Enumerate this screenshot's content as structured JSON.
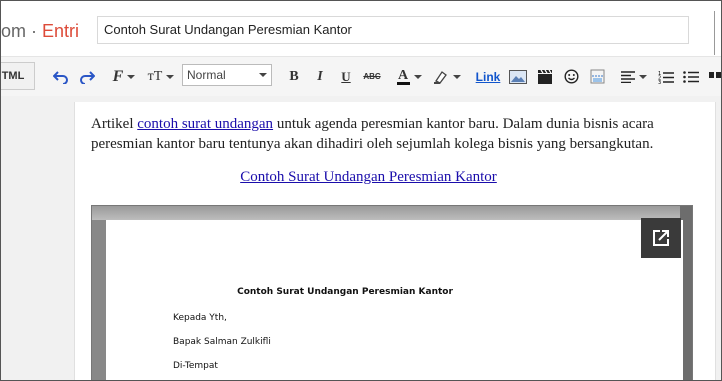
{
  "header": {
    "brand_tail": "om",
    "separator": " · ",
    "section": "Entri",
    "post_title": "Contoh Surat Undangan Peresmian Kantor"
  },
  "toolbar": {
    "html_label": "TML",
    "format_value": "Normal",
    "link_label": "Link",
    "icons": [
      "undo-icon",
      "redo-icon",
      "font-family-icon",
      "font-size-icon",
      "bold-icon",
      "italic-icon",
      "underline-icon",
      "strikethrough-icon",
      "text-color-icon",
      "highlight-icon",
      "image-icon",
      "video-icon",
      "emoji-icon",
      "jump-break-icon",
      "align-icon",
      "numbered-list-icon",
      "bulleted-list-icon",
      "quote-icon"
    ]
  },
  "content": {
    "para_before": "Artikel ",
    "para_link": "contoh surat undangan",
    "para_after": " untuk agenda peresmian kantor baru. Dalam dunia bisnis acara peresmian kantor baru tentunya akan dihadiri oleh sejumlah kolega bisnis yang bersangkutan.",
    "center_link": "Contoh Surat Undangan Peresmian Kantor"
  },
  "document": {
    "title": "Contoh Surat Undangan Peresmian Kantor",
    "lines": [
      "Kepada Yth,",
      "Bapak Salman Zulkifli",
      "Di-Tempat"
    ]
  },
  "colors": {
    "brand": "#dd4b39",
    "link": "#1a0dab",
    "toolbar_link": "#1155cc"
  }
}
